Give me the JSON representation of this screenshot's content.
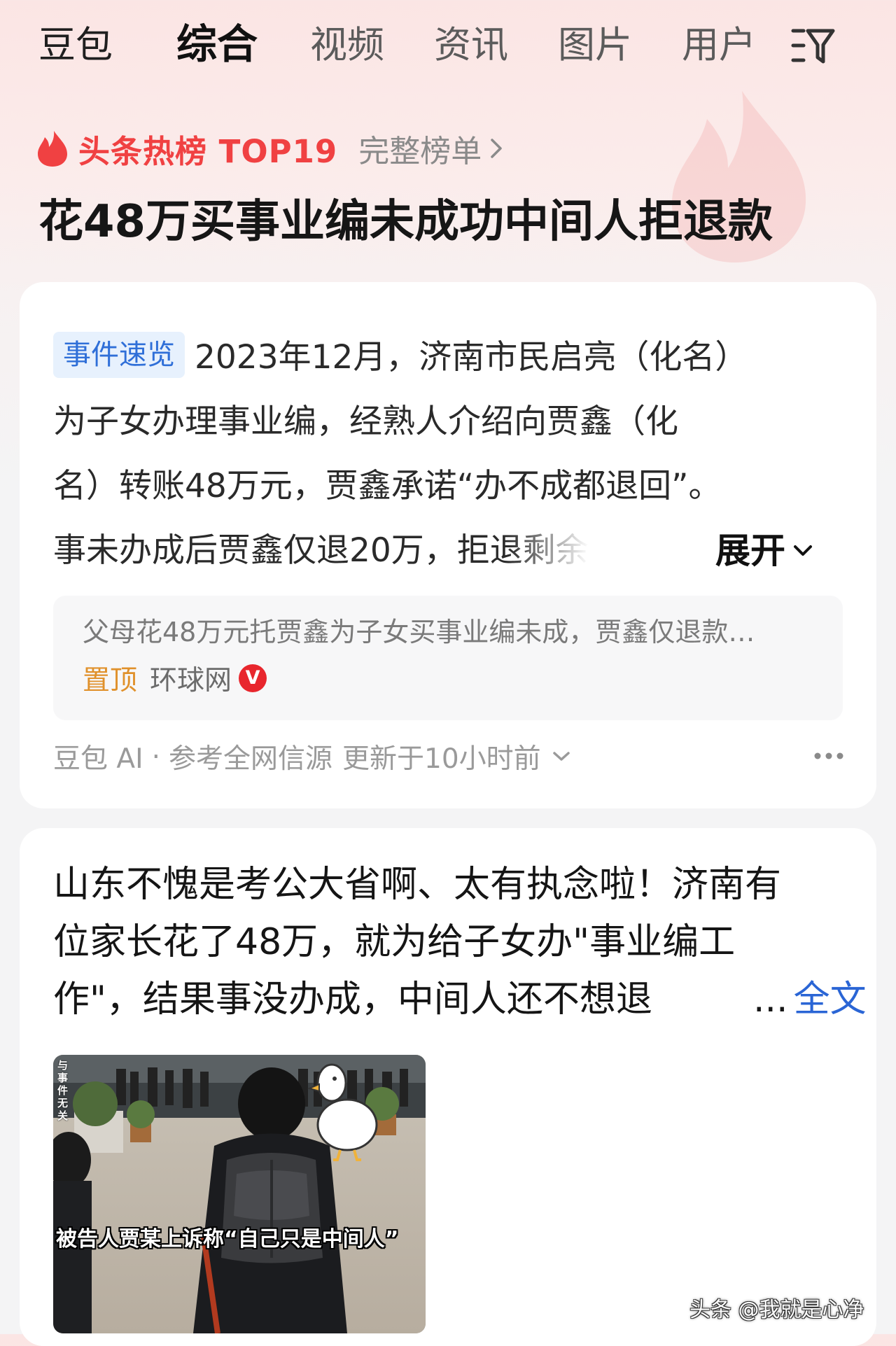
{
  "tabs": [
    {
      "label": "豆包"
    },
    {
      "label": "综合"
    },
    {
      "label": "视频"
    },
    {
      "label": "资讯"
    },
    {
      "label": "图片"
    },
    {
      "label": "用户"
    }
  ],
  "active_tab": "综合",
  "filter_icon": "filter-icon",
  "hot": {
    "label": "头条热榜 TOP19",
    "full_list": "完整榜单",
    "headline": "花48万买事业编未成功中间人拒退款"
  },
  "event_card": {
    "tag": "事件速览",
    "lines": [
      "2023年12月，济南市民启亮（化名）",
      "为子女办理事业编，经熟人介绍向贾鑫（化",
      "名）转账48万元，贾鑫承诺“办不成都退回”。",
      "事未办成后贾鑫仅退20万，拒退剩余"
    ],
    "expand_label": "展开",
    "reference": {
      "title": "父母花48万元托贾鑫为子女买事业编未成，贾鑫仅退款…",
      "pin": "置顶",
      "source": "环球网",
      "verified": "V"
    },
    "footer": {
      "ai": "豆包 AI",
      "dot": "·",
      "sources": "参考全网信源",
      "updated": "更新于10小时前"
    }
  },
  "post_card": {
    "lines": [
      "山东不愧是考公大省啊、太有执念啦！济南有",
      "位家长花了48万，就为给子女办\"事业编工",
      "作\"，结果事没办成，中间人还不想退"
    ],
    "ellipsis": "...",
    "full_text": "全文",
    "image": {
      "caption": "被告人贾某上诉称“自己只是中间人”",
      "disclaimer": "与事件无关"
    }
  },
  "watermark": "头条 @我就是心净",
  "colors": {
    "hot_red": "#f04142",
    "link_blue": "#2a65d5",
    "tag_bg": "#e7f1fd",
    "tag_text": "#2f6fd8",
    "pin_orange": "#e0912b"
  }
}
